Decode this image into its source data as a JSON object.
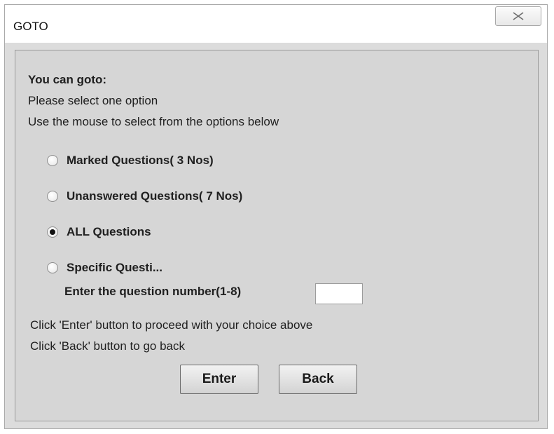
{
  "window": {
    "title": "GOTO",
    "close_icon": "close-icon"
  },
  "dialog": {
    "heading": "You can goto:",
    "line1": "Please select one option",
    "line2": "Use the mouse to select from the options below",
    "options": [
      {
        "label": "Marked Questions( 3 Nos)",
        "selected": false
      },
      {
        "label": "Unanswered Questions( 7 Nos)",
        "selected": false
      },
      {
        "label": "ALL Questions",
        "selected": true
      },
      {
        "label": "Specific Questi...",
        "selected": false
      }
    ],
    "specific_prompt": "Enter the question number(1-8)",
    "question_number_value": "",
    "instruction_enter": "Click 'Enter' button to proceed with your choice above",
    "instruction_back": "Click 'Back' button to go back",
    "enter_label": "Enter",
    "back_label": "Back"
  }
}
